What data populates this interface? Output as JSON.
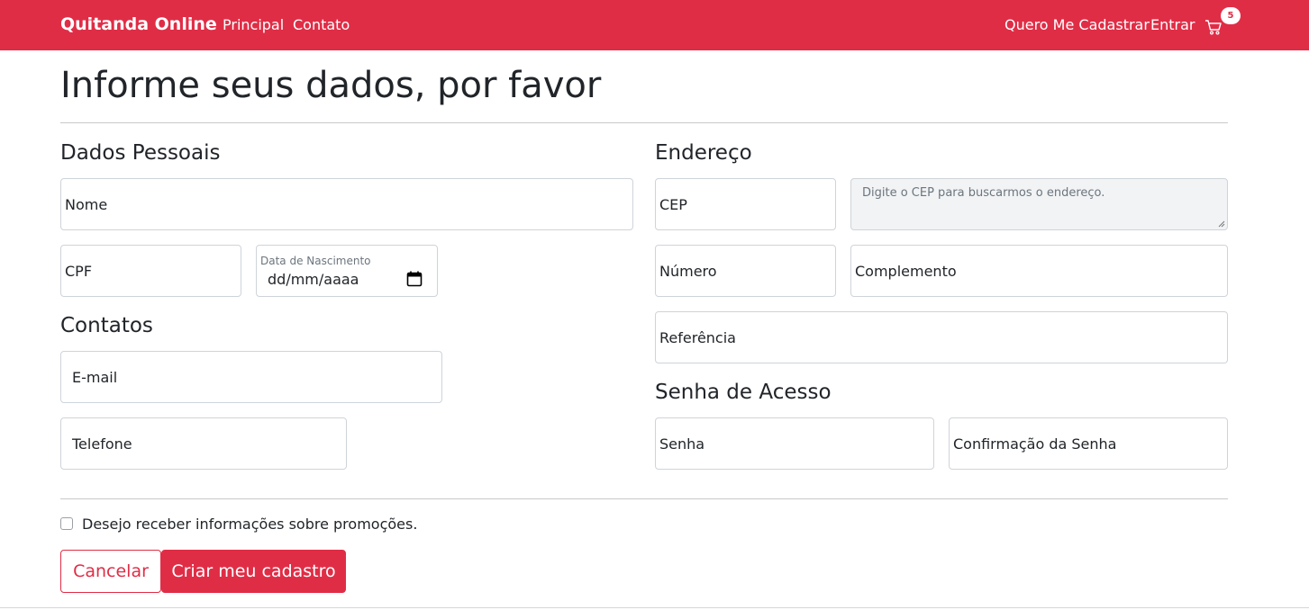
{
  "nav": {
    "brand": "Quitanda Online",
    "links": [
      "Principal",
      "Contato"
    ],
    "register": "Quero Me Cadastrar",
    "login": "Entrar",
    "cart_count": "5",
    "accent": "#e02d46"
  },
  "page": {
    "title": "Informe seus dados, por favor"
  },
  "sections": {
    "personal": "Dados Pessoais",
    "contacts": "Contatos",
    "address": "Endereço",
    "password": "Senha de Acesso"
  },
  "fields": {
    "nome": "Nome",
    "cpf": "CPF",
    "birth_label": "Data de Nascimento",
    "birth_placeholder": "dd/mm/aaaa",
    "email": "E-mail",
    "telefone": "Telefone",
    "cep": "CEP",
    "cep_hint": "Digite o CEP para buscarmos o endereço.",
    "numero": "Número",
    "complemento": "Complemento",
    "referencia": "Referência",
    "senha": "Senha",
    "confirmacao": "Confirmação da Senha"
  },
  "promo_checkbox": {
    "label": "Desejo receber informações sobre promoções.",
    "checked": false
  },
  "buttons": {
    "cancel": "Cancelar",
    "submit": "Criar meu cadastro"
  }
}
